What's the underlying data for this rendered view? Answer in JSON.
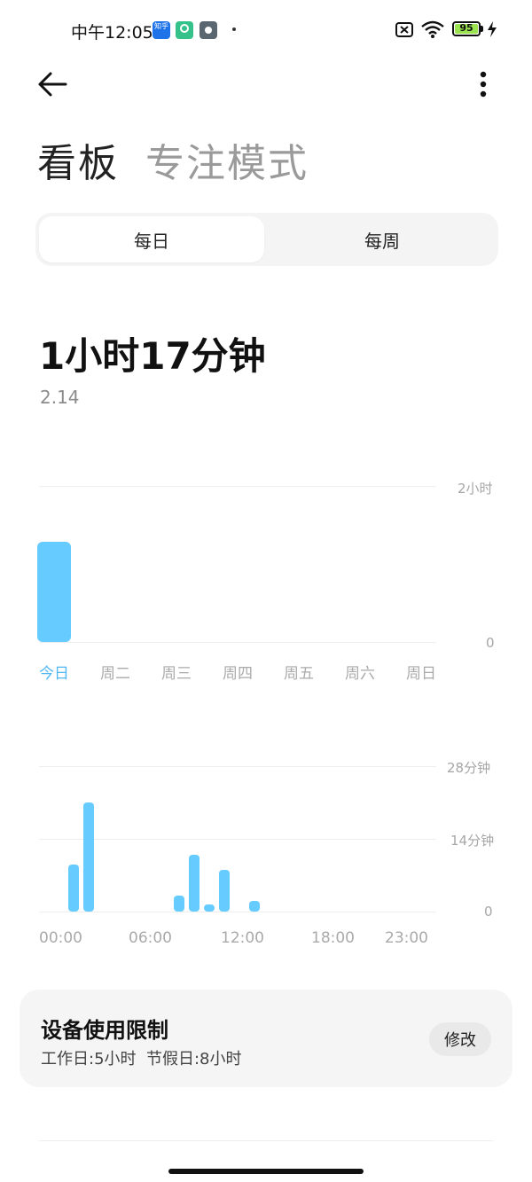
{
  "status_bar": {
    "time": "中午12:05",
    "battery": "95",
    "icons": [
      "zhihu-app-icon",
      "green-app-icon",
      "gray-app-icon",
      "battery-saver-off-icon",
      "wifi-icon",
      "battery-icon",
      "charging-bolt-icon"
    ]
  },
  "header": {
    "back_icon": "back-arrow-icon",
    "more_icon": "more-vertical-icon",
    "tabs": [
      "看板",
      "专注模式"
    ]
  },
  "segment": {
    "options": [
      "每日",
      "每周"
    ],
    "selected": "每日"
  },
  "summary": {
    "total": "1小时17分钟",
    "date": "2.14"
  },
  "chart_data": [
    {
      "type": "bar",
      "categories": [
        "今日",
        "周二",
        "周三",
        "周四",
        "周五",
        "周六",
        "周日"
      ],
      "values": [
        77,
        0,
        0,
        0,
        0,
        0,
        0
      ],
      "unit": "minutes",
      "ylim": [
        0,
        120
      ],
      "ytick_labels": [
        "0",
        "2小时"
      ],
      "highlight_category": "今日",
      "color": "#66ccff"
    },
    {
      "type": "bar",
      "x": [
        0,
        1,
        2,
        3,
        4,
        5,
        6,
        7,
        8,
        9,
        10,
        11,
        12,
        13,
        14,
        15,
        16,
        17,
        18,
        19,
        20,
        21,
        22,
        23
      ],
      "values": [
        0,
        9,
        21,
        0,
        0,
        0,
        0,
        0,
        3,
        11,
        1,
        8,
        0,
        2,
        0,
        0,
        0,
        0,
        0,
        0,
        0,
        0,
        0,
        0
      ],
      "unit": "minutes",
      "ylim": [
        0,
        28
      ],
      "ytick_labels": [
        "0",
        "14分钟",
        "28分钟"
      ],
      "xtick_labels": [
        "00:00",
        "06:00",
        "12:00",
        "18:00",
        "23:00"
      ],
      "color": "#66ccff"
    }
  ],
  "limit_card": {
    "title": "设备使用限制",
    "subtitle": "工作日:5小时  节假日:8小时",
    "edit_label": "修改"
  }
}
